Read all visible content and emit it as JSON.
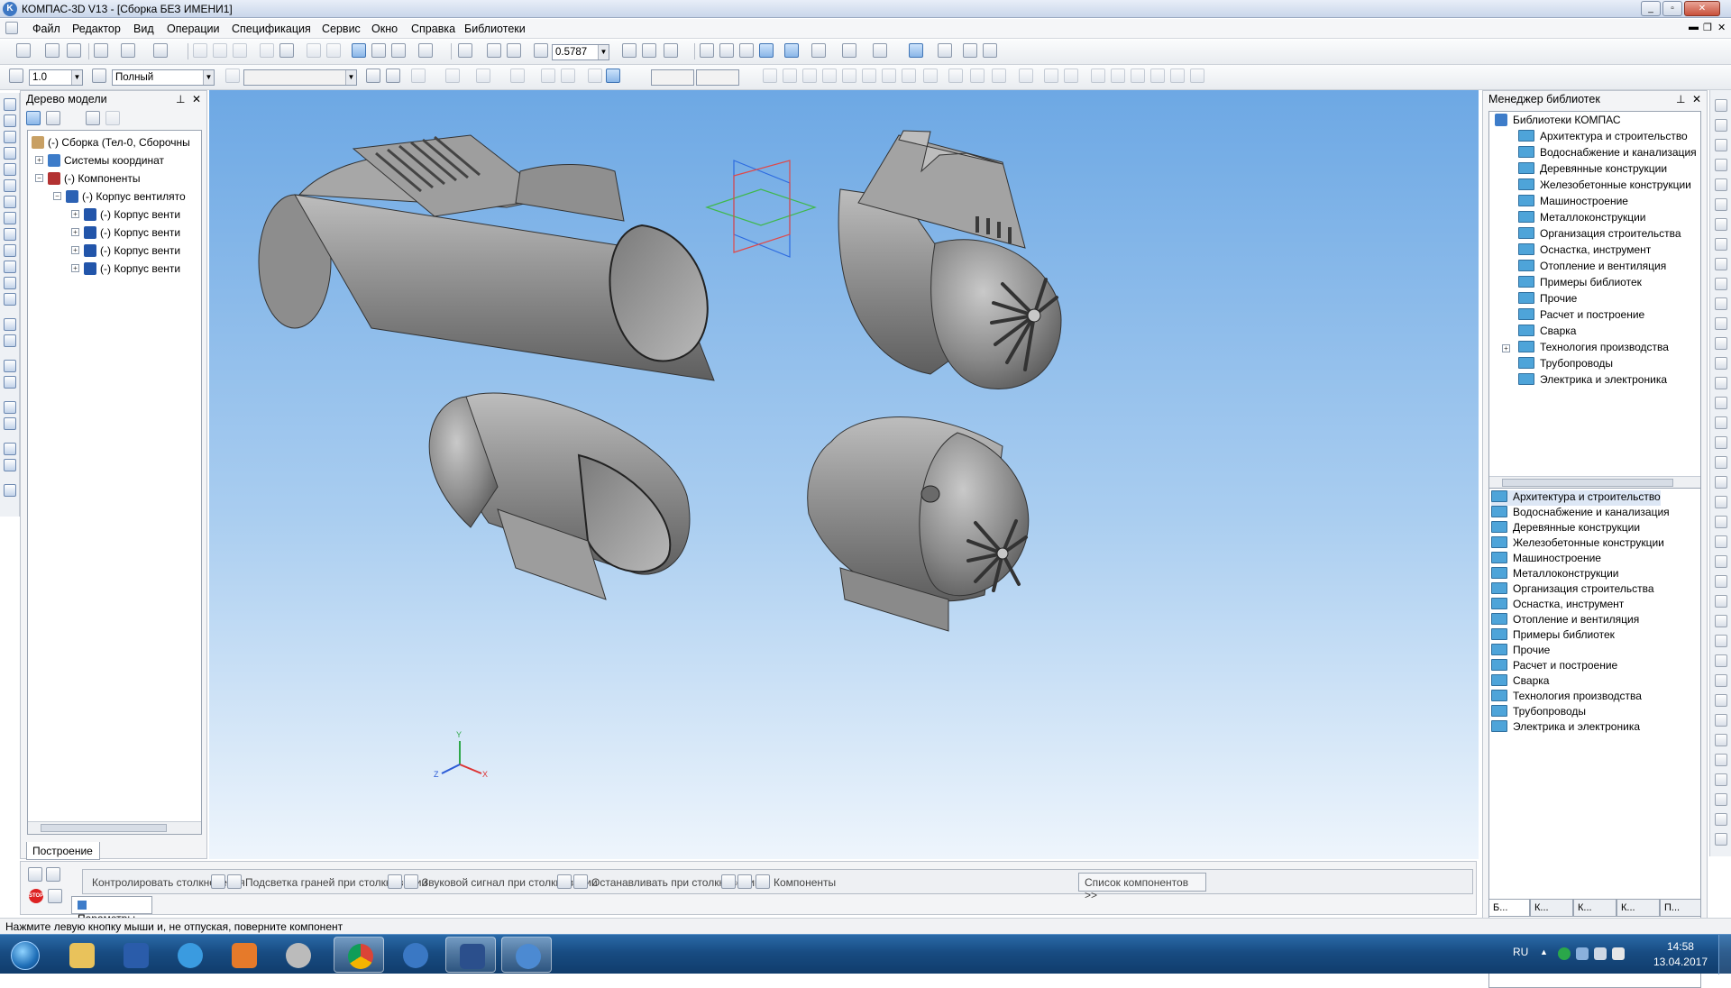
{
  "window": {
    "title": "КОМПАС-3D V13 - [Сборка БЕЗ ИМЕНИ1]",
    "logo": "kompas-logo"
  },
  "menu": [
    "Файл",
    "Редактор",
    "Вид",
    "Операции",
    "Спецификация",
    "Сервис",
    "Окно",
    "Справка",
    "Библиотеки"
  ],
  "toolbar1": {
    "zoom_value": "0.5787"
  },
  "toolbar2": {
    "step_value": "1.0",
    "style_value": "Полный"
  },
  "tree": {
    "title": "Дерево модели",
    "rows": [
      "(-) Сборка (Тел-0, Сборочны",
      "Системы координат",
      "(-) Компоненты",
      "(-) Корпус вентилято",
      "(-) Корпус венти",
      "(-) Корпус венти",
      "(-) Корпус венти",
      "(-) Корпус венти"
    ],
    "tab": "Построение"
  },
  "library_manager": {
    "title": "Менеджер библиотек",
    "root": "Библиотеки КОМПАС",
    "items": [
      "Архитектура и строительство",
      "Водоснабжение и канализация",
      "Деревянные конструкции",
      "Железобетонные конструкции",
      "Машиностроение",
      "Металлоконструкции",
      "Организация строительства",
      "Оснастка, инструмент",
      "Отопление и вентиляция",
      "Примеры библиотек",
      "Прочие",
      "Расчет и построение",
      "Сварка",
      "Технология производства",
      "Трубопроводы",
      "Электрика и электроника"
    ],
    "tabs": [
      "Б...",
      "К...",
      "К...",
      "К...",
      "П..."
    ]
  },
  "properties": {
    "items": [
      "Контролировать столкновения",
      "Подсветка граней при столкновении",
      "Звуковой сигнал при столкновении",
      "Останавливать при столкновении",
      "Компоненты"
    ],
    "button": "Список компонентов  >>",
    "tab": "Параметры"
  },
  "status": "Нажмите левую кнопку мыши и, не отпуская, поверните компонент",
  "taskbar": {
    "lang": "RU",
    "time": "14:58",
    "date": "13.04.2017",
    "apps": [
      "windows-start",
      "file-explorer",
      "word",
      "internet-explorer",
      "media-player",
      "itunes",
      "chrome",
      "kompas-viewer",
      "save-disk",
      "kompas-3d"
    ]
  },
  "viewport": {
    "axis_labels": [
      "Y",
      "Z",
      "X"
    ]
  },
  "colors": {
    "viewport_top": "#6da8e4",
    "viewport_bottom": "#eef5fc",
    "folder": "#4ea4d9",
    "model_gray": "#8c8c8c"
  }
}
